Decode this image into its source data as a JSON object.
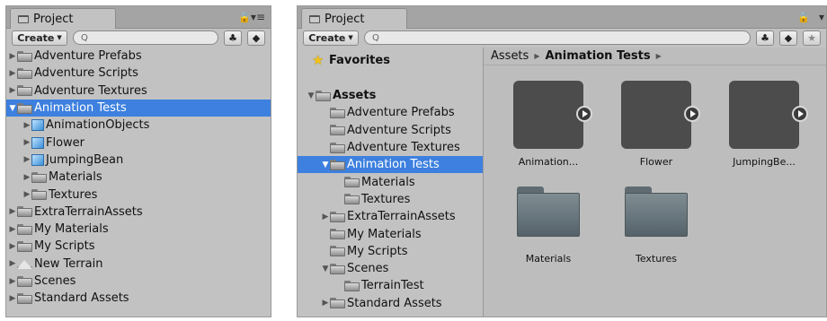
{
  "left_panel": {
    "tab_title": "Project",
    "create_label": "Create",
    "lock_icon": "lock-icon",
    "tree": [
      {
        "label": "Adventure Prefabs",
        "icon": "folder",
        "expand": "▶",
        "depth": 0
      },
      {
        "label": "Adventure Scripts",
        "icon": "folder",
        "expand": "▶",
        "depth": 0
      },
      {
        "label": "Adventure Textures",
        "icon": "folder",
        "expand": "▶",
        "depth": 0
      },
      {
        "label": "Animation Tests",
        "icon": "folder",
        "expand": "▼",
        "depth": 0,
        "selected": true
      },
      {
        "label": "AnimationObjects",
        "icon": "prefab",
        "expand": "▶",
        "depth": 1
      },
      {
        "label": "Flower",
        "icon": "prefab",
        "expand": "▶",
        "depth": 1
      },
      {
        "label": "JumpingBean",
        "icon": "prefab",
        "expand": "▶",
        "depth": 1
      },
      {
        "label": "Materials",
        "icon": "folder",
        "expand": "▶",
        "depth": 1
      },
      {
        "label": "Textures",
        "icon": "folder",
        "expand": "▶",
        "depth": 1
      },
      {
        "label": "ExtraTerrainAssets",
        "icon": "folder",
        "expand": "▶",
        "depth": 0
      },
      {
        "label": "My Materials",
        "icon": "folder",
        "expand": "▶",
        "depth": 0
      },
      {
        "label": "My Scripts",
        "icon": "folder",
        "expand": "▶",
        "depth": 0
      },
      {
        "label": "New Terrain",
        "icon": "terrain",
        "expand": "▶",
        "depth": 0
      },
      {
        "label": "Scenes",
        "icon": "folder",
        "expand": "▶",
        "depth": 0
      },
      {
        "label": "Standard Assets",
        "icon": "folder",
        "expand": "▶",
        "depth": 0
      }
    ]
  },
  "right_panel": {
    "tab_title": "Project",
    "create_label": "Create",
    "favorites_label": "Favorites",
    "tree": [
      {
        "label": "Assets",
        "icon": "folder",
        "expand": "▼",
        "depth": 0,
        "bold": true
      },
      {
        "label": "Adventure Prefabs",
        "icon": "folder",
        "expand": "",
        "depth": 1
      },
      {
        "label": "Adventure Scripts",
        "icon": "folder",
        "expand": "",
        "depth": 1
      },
      {
        "label": "Adventure Textures",
        "icon": "folder",
        "expand": "",
        "depth": 1
      },
      {
        "label": "Animation Tests",
        "icon": "folder",
        "expand": "▼",
        "depth": 1,
        "selected": true
      },
      {
        "label": "Materials",
        "icon": "folder",
        "expand": "",
        "depth": 2
      },
      {
        "label": "Textures",
        "icon": "folder",
        "expand": "",
        "depth": 2
      },
      {
        "label": "ExtraTerrainAssets",
        "icon": "folder",
        "expand": "▶",
        "depth": 1
      },
      {
        "label": "My Materials",
        "icon": "folder",
        "expand": "",
        "depth": 1
      },
      {
        "label": "My Scripts",
        "icon": "folder",
        "expand": "",
        "depth": 1
      },
      {
        "label": "Scenes",
        "icon": "folder",
        "expand": "▼",
        "depth": 1
      },
      {
        "label": "TerrainTest",
        "icon": "folder",
        "expand": "",
        "depth": 2
      },
      {
        "label": "Standard Assets",
        "icon": "folder",
        "expand": "▶",
        "depth": 1
      }
    ],
    "breadcrumb": {
      "root": "Assets",
      "current": "Animation Tests"
    },
    "grid_items": [
      {
        "label": "Animation...",
        "kind": "prefab"
      },
      {
        "label": "Flower",
        "kind": "prefab"
      },
      {
        "label": "JumpingBe...",
        "kind": "prefab"
      },
      {
        "label": "Materials",
        "kind": "folder"
      },
      {
        "label": "Textures",
        "kind": "folder"
      }
    ]
  }
}
